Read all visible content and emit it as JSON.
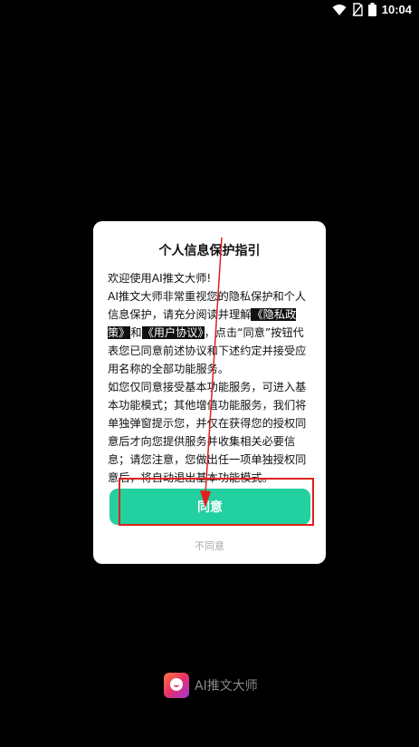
{
  "status_bar": {
    "time": "10:04",
    "icons": [
      "wifi-icon",
      "no-sim-icon",
      "battery-icon"
    ]
  },
  "dialog": {
    "title": "个人信息保护指引",
    "paragraph1_greeting": "欢迎使用AI推文大师!",
    "paragraph2_part1": "AI推文大师非常重视您的隐私保护和个人信息保护，请充分阅读并理解",
    "privacy_link": "《隐私政策》",
    "and": "和",
    "agreement_link": "《用户协议》",
    "paragraph2_part2": "，点击“同意”按钮代表您已同意前述协议和下述约定并接受应用名称的全部功能服务。",
    "paragraph3": "如您仅同意接受基本功能服务，可进入基本功能模式；其他增值功能服务，我们将单独弹窗提示您，并仅在获得您的授权同意后才向您提供服务并收集相关必要信息；请您注意，您做出任一项单独授权同意后，将自动退出基本功能模式。",
    "agree_label": "同意",
    "disagree_label": "不同意"
  },
  "brand": {
    "app_name": "AI推文大师",
    "logo_icon": "app-logo-icon"
  },
  "colors": {
    "background": "#000000",
    "dialog_bg": "#ffffff",
    "accent": "#22d0a0",
    "annotation": "#e02020"
  }
}
